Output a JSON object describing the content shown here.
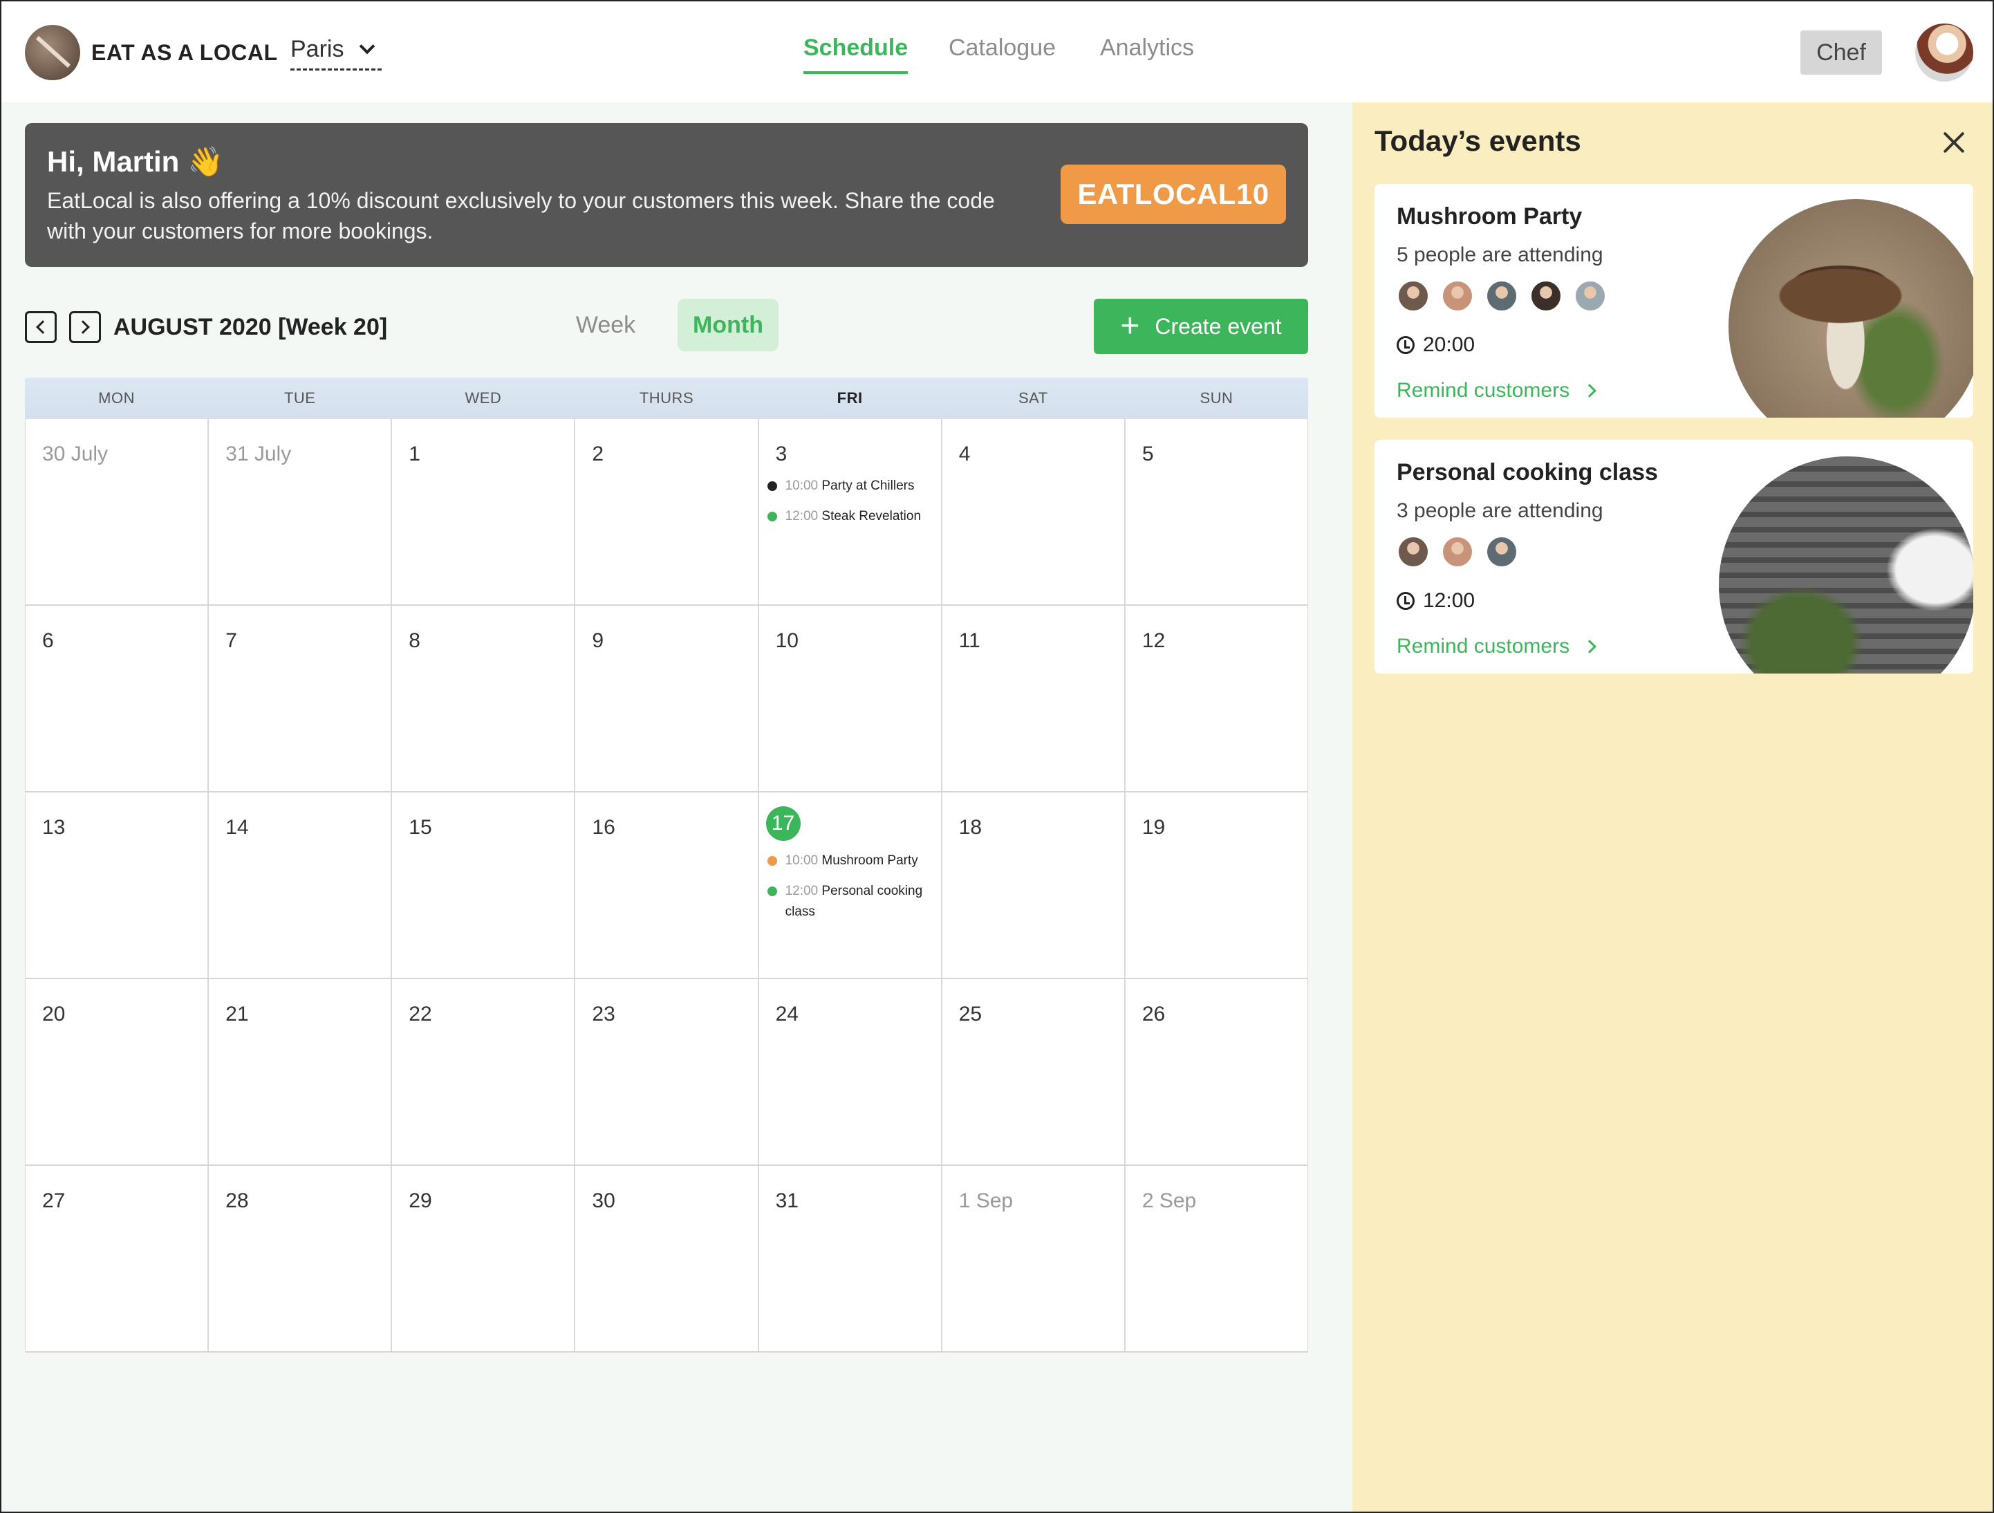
{
  "header": {
    "brand": "EAT AS A LOCAL",
    "city": "Paris",
    "nav": [
      {
        "label": "Schedule",
        "active": true
      },
      {
        "label": "Catalogue",
        "active": false
      },
      {
        "label": "Analytics",
        "active": false
      }
    ],
    "role_label": "Chef"
  },
  "banner": {
    "greeting": "Hi, Martin 👋",
    "message": "EatLocal is also offering a 10% discount exclusively to your customers this week. Share the code with your customers for more bookings.",
    "code": "EATLOCAL10"
  },
  "toolbar": {
    "period": "AUGUST 2020 [Week 20]",
    "views": [
      "Week",
      "Month"
    ],
    "active_view": "Month",
    "create_label": "Create event"
  },
  "calendar": {
    "weekdays": [
      "MON",
      "TUE",
      "WED",
      "THURS",
      "FRI",
      "SAT",
      "SUN"
    ],
    "today_weekday": "FRI",
    "weeks": [
      [
        {
          "day": "30 July",
          "muted": true,
          "events": []
        },
        {
          "day": "31 July",
          "muted": true,
          "events": []
        },
        {
          "day": "1",
          "events": []
        },
        {
          "day": "2",
          "events": []
        },
        {
          "day": "3",
          "events": [
            {
              "time": "10:00",
              "title": "Party at Chillers",
              "color": "#222222"
            },
            {
              "time": "12:00",
              "title": "Steak Revelation",
              "color": "#3db55a"
            }
          ]
        },
        {
          "day": "4",
          "events": []
        },
        {
          "day": "5",
          "events": []
        }
      ],
      [
        {
          "day": "6",
          "events": []
        },
        {
          "day": "7",
          "events": []
        },
        {
          "day": "8",
          "events": []
        },
        {
          "day": "9",
          "events": []
        },
        {
          "day": "10",
          "events": []
        },
        {
          "day": "11",
          "events": []
        },
        {
          "day": "12",
          "events": []
        }
      ],
      [
        {
          "day": "13",
          "events": []
        },
        {
          "day": "14",
          "events": []
        },
        {
          "day": "15",
          "events": []
        },
        {
          "day": "16",
          "events": []
        },
        {
          "day": "17",
          "today": true,
          "events": [
            {
              "time": "10:00",
              "title": "Mushroom Party",
              "color": "#ee9a47"
            },
            {
              "time": "12:00",
              "title": "Personal cooking class",
              "color": "#3db55a"
            }
          ]
        },
        {
          "day": "18",
          "events": []
        },
        {
          "day": "19",
          "events": []
        }
      ],
      [
        {
          "day": "20",
          "events": []
        },
        {
          "day": "21",
          "events": []
        },
        {
          "day": "22",
          "events": []
        },
        {
          "day": "23",
          "events": []
        },
        {
          "day": "24",
          "events": []
        },
        {
          "day": "25",
          "events": []
        },
        {
          "day": "26",
          "events": []
        }
      ],
      [
        {
          "day": "27",
          "events": []
        },
        {
          "day": "28",
          "events": []
        },
        {
          "day": "29",
          "events": []
        },
        {
          "day": "30",
          "events": []
        },
        {
          "day": "31",
          "events": []
        },
        {
          "day": "1 Sep",
          "muted": true,
          "events": []
        },
        {
          "day": "2 Sep",
          "muted": true,
          "events": []
        }
      ]
    ]
  },
  "sidebar": {
    "title": "Today’s events",
    "events": [
      {
        "title": "Mushroom Party",
        "attending": "5 people are attending",
        "time": "20:00",
        "remind_label": "Remind customers",
        "avatar_colors": [
          "#6d5a4c",
          "#c9937a",
          "#5d6b73",
          "#3c2f2a",
          "#9aa8b2"
        ]
      },
      {
        "title": "Personal cooking class",
        "attending": "3 people are attending",
        "time": "12:00",
        "remind_label": "Remind customers",
        "avatar_colors": [
          "#6d5a4c",
          "#c9937a",
          "#5d6b73"
        ]
      }
    ]
  },
  "colors": {
    "accent": "#3db55a",
    "promo": "#ee9a47",
    "banner_bg": "#565656",
    "sidebar_bg": "#faeec1"
  }
}
